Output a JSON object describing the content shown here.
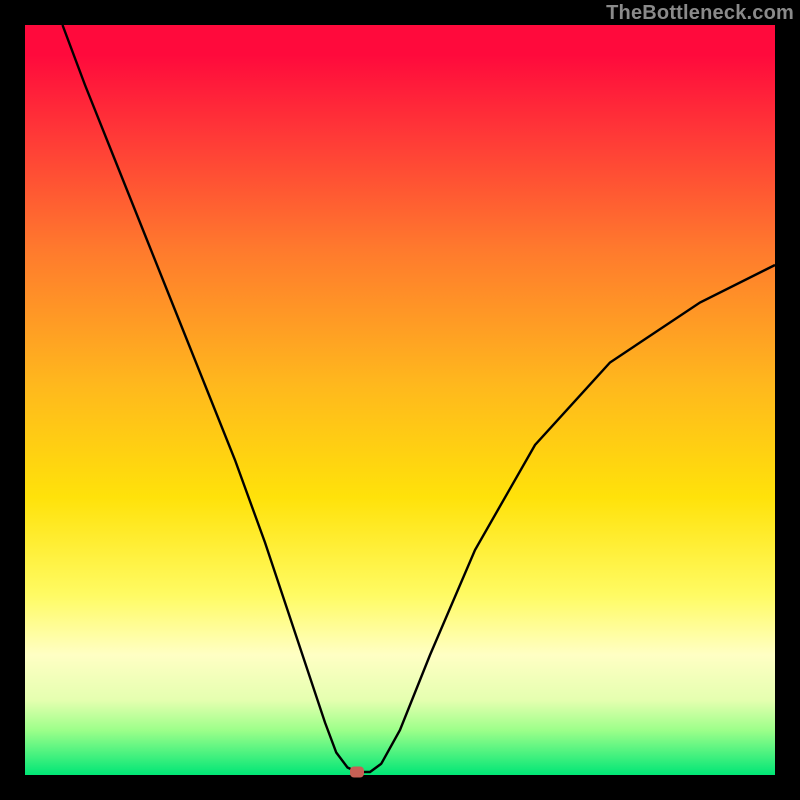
{
  "watermark": "TheBottleneck.com",
  "marker": {
    "color": "#c76055",
    "x_frac": 0.443,
    "y_frac": 0.996
  },
  "chart_data": {
    "type": "line",
    "title": "",
    "xlabel": "",
    "ylabel": "",
    "xlim": [
      0,
      100
    ],
    "ylim": [
      0,
      100
    ],
    "series": [
      {
        "name": "curve",
        "x": [
          5,
          8,
          12,
          16,
          20,
          24,
          28,
          32,
          35,
          38,
          40,
          41.5,
          43,
          44.3,
          46,
          47.5,
          50,
          54,
          60,
          68,
          78,
          90,
          100
        ],
        "y": [
          100,
          92,
          82,
          72,
          62,
          52,
          42,
          31,
          22,
          13,
          7,
          3,
          1,
          0.4,
          0.4,
          1.5,
          6,
          16,
          30,
          44,
          55,
          63,
          68
        ]
      }
    ],
    "marker_point": {
      "x": 44.3,
      "y": 0.4
    },
    "gradient_stops": [
      {
        "pct": 0,
        "color": "#ff0a3c"
      },
      {
        "pct": 15,
        "color": "#ff3a37"
      },
      {
        "pct": 30,
        "color": "#ff7a2d"
      },
      {
        "pct": 48,
        "color": "#ffb81d"
      },
      {
        "pct": 63,
        "color": "#ffe20a"
      },
      {
        "pct": 76,
        "color": "#fffb63"
      },
      {
        "pct": 84,
        "color": "#ffffc4"
      },
      {
        "pct": 90,
        "color": "#e5ffb0"
      },
      {
        "pct": 94,
        "color": "#9dff8a"
      },
      {
        "pct": 100,
        "color": "#00e676"
      }
    ]
  }
}
